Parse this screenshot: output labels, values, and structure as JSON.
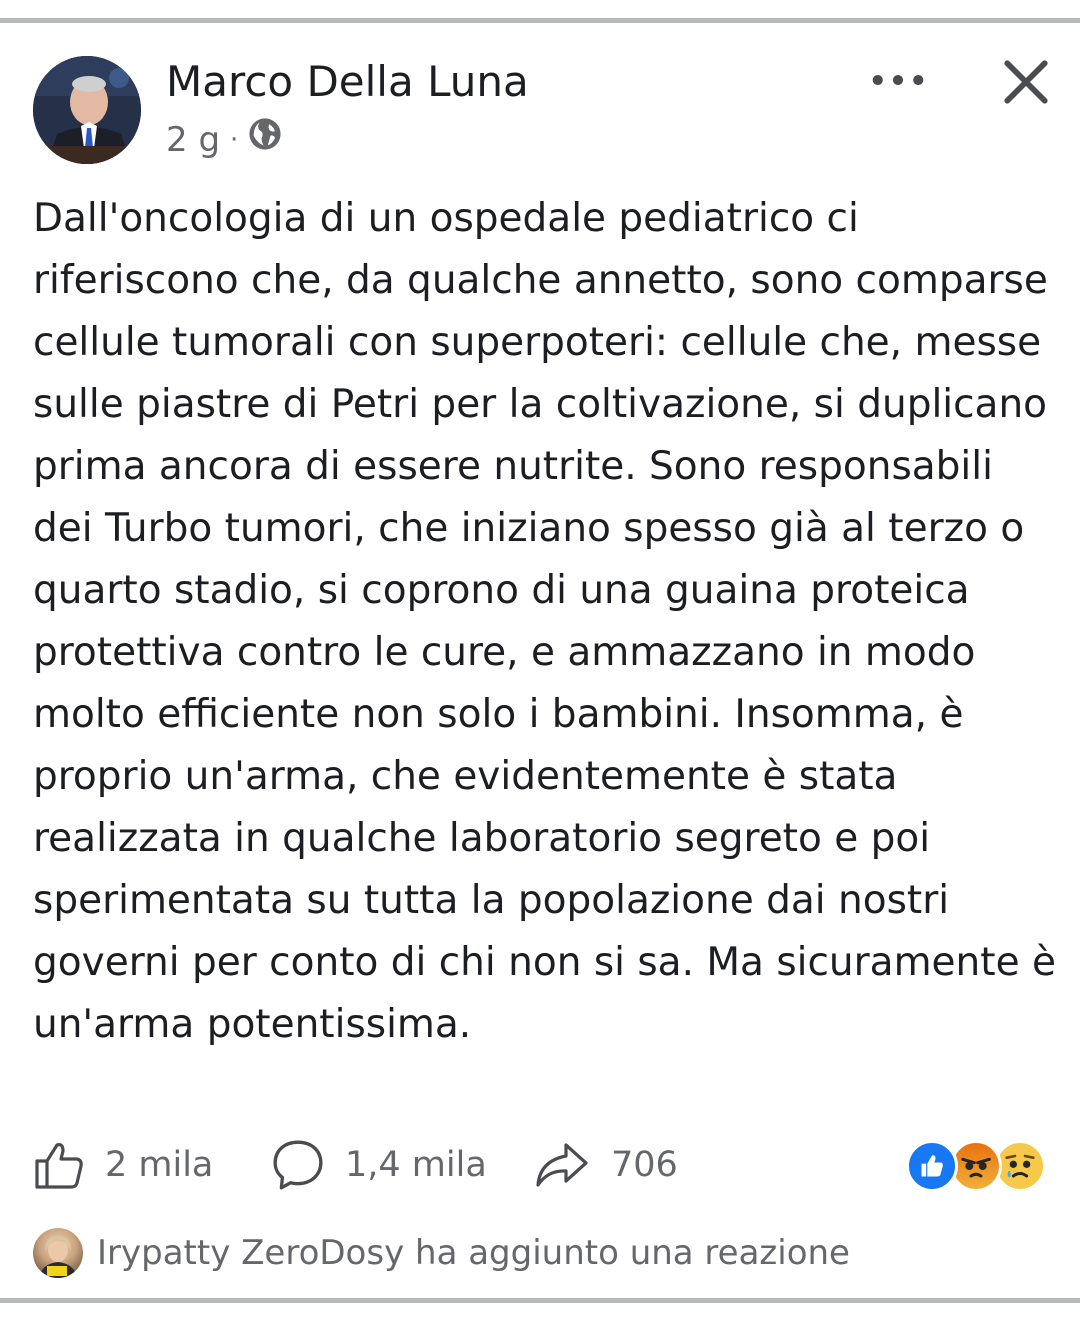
{
  "post": {
    "author": "Marco Della Luna",
    "time": "2 g",
    "separator": "·",
    "audience_icon": "globe-icon",
    "body": "Dall'oncologia di un ospedale pediatrico ci riferiscono che, da qualche annetto, sono comparse cellule tumorali con superpoteri: cellule che, messe sulle piastre di Petri per la coltivazione, si duplicano prima ancora di essere nutrite. Sono responsabili dei Turbo tumori, che iniziano spesso già al terzo o quarto stadio, si coprono di una guaina proteica protettiva contro le cure, e ammazzano in modo molto efficiente non solo i bambini. Insomma, è proprio un'arma, che evidentemente è stata realizzata in qualche laboratorio segreto e poi sperimentata su tutta la popolazione dai nostri governi per conto di chi non si sa. Ma sicuramente è un'arma potentissima."
  },
  "header_actions": {
    "more_icon": "more-options-icon",
    "close_icon": "close-icon"
  },
  "stats": {
    "likes": "2 mila",
    "comments": "1,4 mila",
    "shares": "706"
  },
  "reactions": [
    "like",
    "angry",
    "sad"
  ],
  "activity": {
    "name": "Irypatty ZeroDosy",
    "action": "ha aggiunto una reazione"
  },
  "colors": {
    "text": "#1c1e21",
    "secondary": "#65676b",
    "like_blue": "#1877f2",
    "divider": "#b8b9bb"
  }
}
